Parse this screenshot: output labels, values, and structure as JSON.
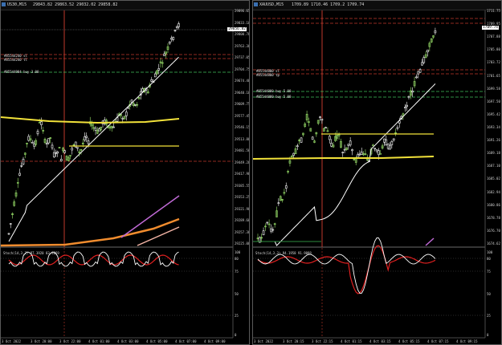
{
  "left": {
    "title": "US30,M15",
    "ohlc": "29843.82 29863.52 29032.02 29858.82",
    "price_scale": [
      "29896.65",
      "29833.10",
      "29800.70",
      "29763.30",
      "29737.05",
      "29704.75",
      "29674.40",
      "29640.10",
      "29609.75",
      "29577.45",
      "29546.15",
      "29513.80",
      "29481.50",
      "29449.20",
      "29417.90",
      "29385.55",
      "29353.25",
      "29321.90",
      "29289.60",
      "29257.30",
      "29225.00"
    ],
    "current_price": "29856.82",
    "orders": [
      "#85544240 sl",
      "#85544240 tl",
      "#85544904 buy 3.00"
    ],
    "time_labels": [
      "3 Oct 2022",
      "3 Oct 20:00",
      "3 Oct 22:00",
      "4 Oct 01:00",
      "4 Oct 03:00",
      "4 Oct 05:00",
      "4 Oct 07:00",
      "4 Oct 09:00"
    ],
    "stoch_label": "Stoch(14,3,3) 87.3920 83.4069",
    "stoch_scale": [
      "100",
      "80",
      "75",
      "50",
      "25",
      "0"
    ]
  },
  "right": {
    "title": "XAUUSD,M15",
    "ohlc": "1709.89 1710.46 1709.2 1709.74",
    "price_scale": [
      "1711.75",
      "1709.95",
      "1707.88",
      "1705.80",
      "1703.72",
      "1701.65",
      "1699.58",
      "1697.50",
      "1695.42",
      "1693.34",
      "1691.26",
      "1689.18",
      "1687.10",
      "1685.02",
      "1682.94",
      "1680.86",
      "1678.78",
      "1676.70",
      "1674.62"
    ],
    "current_price": "1709.74",
    "orders": [
      "#85544800 sl",
      "#85544800 tp",
      "#85544800 buy 5.00",
      "#85544800 buy 5.00"
    ],
    "time_labels": [
      "3 Oct 2022",
      "3 Oct 20:15",
      "3 Oct 22:15",
      "4 Oct 01:15",
      "4 Oct 03:15",
      "4 Oct 05:15",
      "4 Oct 07:15",
      "4 Oct 09:15"
    ],
    "stoch_label": "Stoch(14,3,3) 94.1958 91.9088",
    "stoch_scale": [
      "100",
      "80",
      "75",
      "50",
      "25",
      "0"
    ]
  },
  "colors": {
    "bull": "#9be36b",
    "bear": "#ffffff",
    "ma_white": "#ffffff",
    "ma_yellow": "#f2e23a",
    "ma_orange": "#f08c2e",
    "ma_violet": "#c06ad6",
    "ma_pink": "#f4b5a6",
    "sl_red": "#c0392b",
    "tp_green": "#3fbf5a",
    "stoch_main": "#ffffff",
    "stoch_signal": "#e02020"
  }
}
